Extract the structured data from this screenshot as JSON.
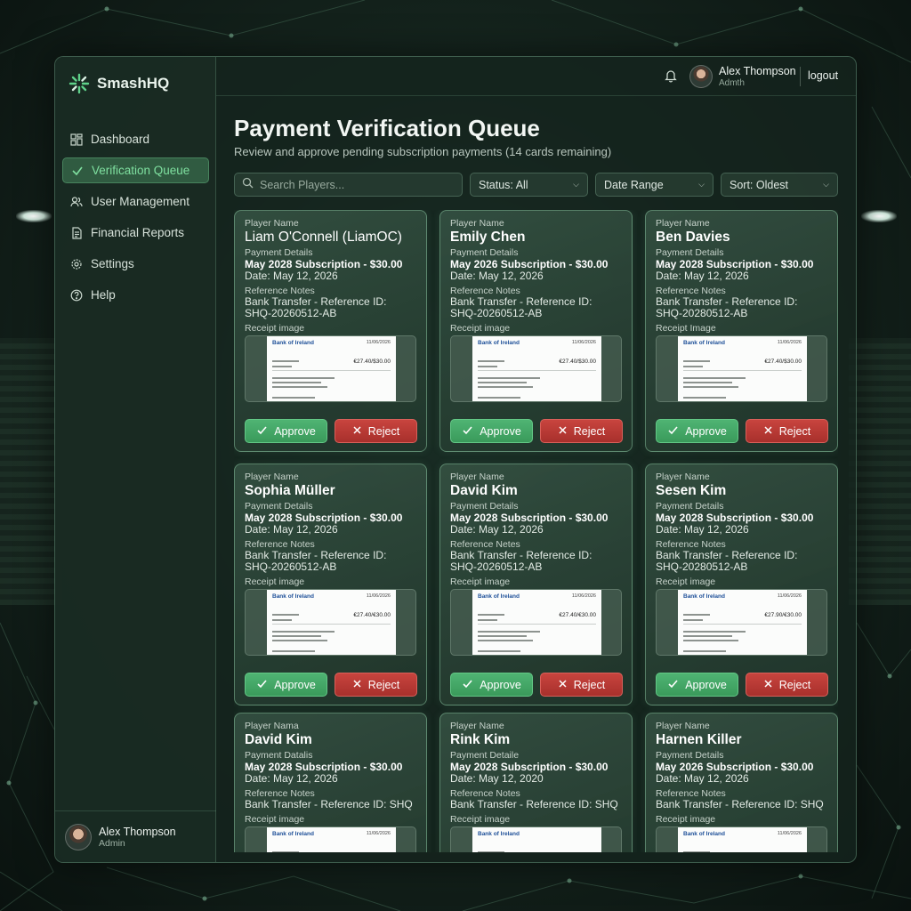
{
  "app": {
    "name": "SmashHQ"
  },
  "sidebar": {
    "items": [
      {
        "label": "Dashboard",
        "icon": "dashboard-icon"
      },
      {
        "label": "Verification Queue",
        "icon": "check-icon",
        "active": true
      },
      {
        "label": "User Management",
        "icon": "users-icon"
      },
      {
        "label": "Financial Reports",
        "icon": "document-icon"
      },
      {
        "label": "Settings",
        "icon": "gear-icon"
      },
      {
        "label": "Help",
        "icon": "help-icon"
      }
    ],
    "user": {
      "name": "Alex Thompson",
      "role": "Admin"
    }
  },
  "topbar": {
    "user_name": "Alex Thompson",
    "user_role": "Admth",
    "logout": "logout"
  },
  "page": {
    "title": "Payment Verification Queue",
    "subtitle": "Review and approve pending subscription payments (14 cards remaining)"
  },
  "filters": {
    "search_placeholder": "Search Players...",
    "status": "Status: All",
    "date": "Date Range",
    "sort": "Sort: Oldest"
  },
  "buttons": {
    "approve": "Approve",
    "reject": "Reject"
  },
  "cards": [
    {
      "name_label": "Player Name",
      "name": "Liam O'Connell (LiamOC)",
      "pay_label": "Payment Details",
      "subscription": "May 2028 Subscription - $30.00",
      "date": "Date: May 12, 2026",
      "notes_label": "Reference Notes",
      "notes1": "Bank Transfer - Reference ID:",
      "notes2": "SHQ-20260512-AB",
      "receipt_label": "Receipt image",
      "bank": "Bank of Ireland",
      "rdate": "11/06/2026",
      "amount": "€27.40/$30.00"
    },
    {
      "name_label": "Player Name",
      "name": "Emily Chen",
      "pay_label": "Payment Details",
      "subscription": "May 2026 Subscription - $30.00",
      "date": "Date: May 12, 2026",
      "notes_label": "Reference Notes",
      "notes1": "Bank Transfer - Reference ID:",
      "notes2": "SHQ-20260512-AB",
      "receipt_label": "Receipt image",
      "bank": "Bank of Ireland",
      "rdate": "11/06/2026",
      "amount": "€27.40/$30.00"
    },
    {
      "name_label": "Player Name",
      "name": "Ben Davies",
      "pay_label": "Payment Details",
      "subscription": "May 2028 Subscription - $30.00",
      "date": "Date: May 12, 2026",
      "notes_label": "Reference Notes",
      "notes1": "Bank Transfer - Reference ID:",
      "notes2": "SHQ-20280512-AB",
      "receipt_label": "Receipt Image",
      "bank": "Bank of Ireland",
      "rdate": "11/06/2026",
      "amount": "€27.40/$30.00"
    },
    {
      "name_label": "Player Name",
      "name": "Sophia Müller",
      "pay_label": "Payment Details",
      "subscription": "May 2028 Subscription - $30.00",
      "date": "Date: May 12, 2026",
      "notes_label": "Reference Notes",
      "notes1": "Bank Transfer - Reference ID:",
      "notes2": "SHQ-20260512-AB",
      "receipt_label": "Receipt image",
      "bank": "Bank of Ireland",
      "rdate": "11/06/2026",
      "amount": "€27.40/€30.00"
    },
    {
      "name_label": "Player Name",
      "name": "David Kim",
      "pay_label": "Payment Details",
      "subscription": "May 2028 Subscription - $30.00",
      "date": "Date: May 12, 2026",
      "notes_label": "Reference Netes",
      "notes1": "Bank Transfer - Reference ID:",
      "notes2": "SHQ-20260512-AB",
      "receipt_label": "Receipt image",
      "bank": "Bank of Ireland",
      "rdate": "11/06/2026",
      "amount": "€27.40/€30.00"
    },
    {
      "name_label": "Player Name",
      "name": "Sesen Kim",
      "pay_label": "Payment Details",
      "subscription": "May 2028 Subscription - $30.00",
      "date": "Date: May 12, 2026",
      "notes_label": "Reference Notes",
      "notes1": "Bank Transfer - Reference ID:",
      "notes2": "SHQ-20280512-AB",
      "receipt_label": "Receipt image",
      "bank": "Bank of Ireland",
      "rdate": "11/06/2026",
      "amount": "€27.90/€30.00"
    },
    {
      "name_label": "Player Nama",
      "name": "David Kim",
      "pay_label": "Payment Datalis",
      "subscription": "May 2028 Subscription - $30.00",
      "date": "Date: May 12, 2026",
      "notes_label": "Reference Notes",
      "notes1": "Bank Transfer - Reference ID: SHQ",
      "notes2": "",
      "receipt_label": "Receipt image",
      "bank": "Bank of Ireland",
      "rdate": "11/06/2026",
      "amount": ""
    },
    {
      "name_label": "Player Name",
      "name": "Rink Kim",
      "pay_label": "Payment Detaile",
      "subscription": "May 2028 Subscription - $30.00",
      "date": "Date: May 12, 2020",
      "notes_label": "Reference Notes",
      "notes1": "Bank Transfer - Reference ID: SHQ",
      "notes2": "",
      "receipt_label": "Receipt image",
      "bank": "Bank of Ireland",
      "rdate": "",
      "amount": ""
    },
    {
      "name_label": "Player Name",
      "name": "Harnen Killer",
      "pay_label": "Payment Details",
      "subscription": "May 2026 Subscription - $30.00",
      "date": "Date: May 12, 2026",
      "notes_label": "Reference Notes",
      "notes1": "Bank Transfer - Reference ID: SHQ",
      "notes2": "",
      "receipt_label": "Receipt image",
      "bank": "Bank of Ireland",
      "rdate": "11/06/2026",
      "amount": ""
    }
  ],
  "colors": {
    "accent": "#4fb473",
    "reject": "#c8443e",
    "bank_blue": "#1d4f98"
  }
}
